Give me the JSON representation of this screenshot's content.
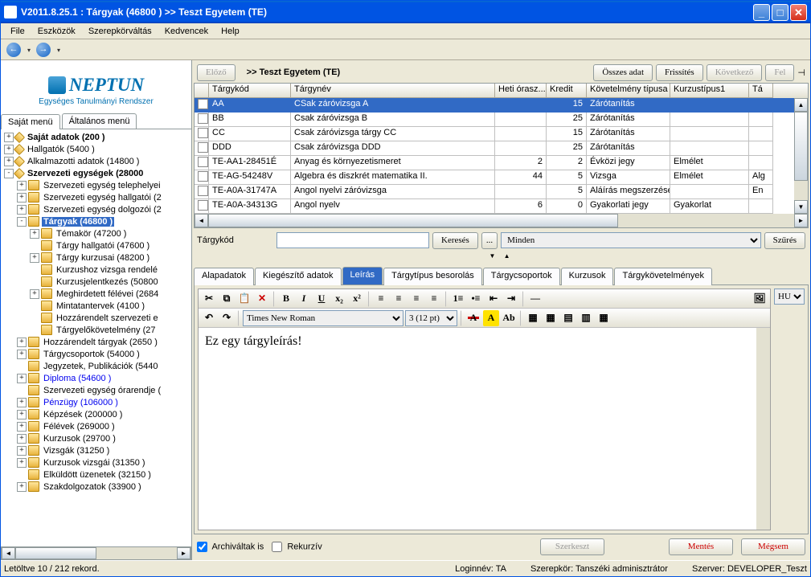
{
  "title": "V2011.8.25.1 : Tárgyak (46800  )   >> Teszt Egyetem  (TE)",
  "menu": [
    "File",
    "Eszközök",
    "Szerepkörváltás",
    "Kedvencek",
    "Help"
  ],
  "logo": {
    "main": "NEPTUN",
    "sub": "Egységes Tanulmányi Rendszer"
  },
  "lefttabs": [
    "Saját menü",
    "Általános menü"
  ],
  "tree": [
    {
      "d": 0,
      "exp": "+",
      "bold": true,
      "ico": "diamond",
      "label": "Saját adatok (200  )"
    },
    {
      "d": 0,
      "exp": "+",
      "ico": "diamond",
      "label": "Hallgatók (5400  )"
    },
    {
      "d": 0,
      "exp": "+",
      "ico": "diamond",
      "label": "Alkalmazotti adatok (14800  )"
    },
    {
      "d": 0,
      "exp": "-",
      "bold": true,
      "ico": "diamond",
      "label": "Szervezeti egységek (28000"
    },
    {
      "d": 1,
      "exp": "+",
      "label": "Szervezeti egység telephelyei"
    },
    {
      "d": 1,
      "exp": "+",
      "label": "Szervezeti egység hallgatói (2"
    },
    {
      "d": 1,
      "exp": "+",
      "label": "Szervezeti egység dolgozói (2"
    },
    {
      "d": 1,
      "exp": "-",
      "bold": true,
      "sel": true,
      "label": "Tárgyak (46800  )"
    },
    {
      "d": 2,
      "exp": "+",
      "label": "Témakör (47200  )"
    },
    {
      "d": 2,
      "exp": " ",
      "label": "Tárgy hallgatói (47600  )"
    },
    {
      "d": 2,
      "exp": "+",
      "label": "Tárgy kurzusai (48200  )"
    },
    {
      "d": 2,
      "exp": " ",
      "label": "Kurzushoz vizsga rendelé"
    },
    {
      "d": 2,
      "exp": " ",
      "label": "Kurzusjelentkezés (50800"
    },
    {
      "d": 2,
      "exp": "+",
      "label": "Meghirdetett félévei (2684"
    },
    {
      "d": 2,
      "exp": " ",
      "label": "Mintatantervek (4100  )"
    },
    {
      "d": 2,
      "exp": " ",
      "label": "Hozzárendelt szervezeti e"
    },
    {
      "d": 2,
      "exp": " ",
      "label": "Tárgyelőkövetelmény (27"
    },
    {
      "d": 1,
      "exp": "+",
      "label": "Hozzárendelt tárgyak (2650  )"
    },
    {
      "d": 1,
      "exp": "+",
      "label": "Tárgycsoportok (54000  )"
    },
    {
      "d": 1,
      "exp": " ",
      "label": "Jegyzetek, Publikációk (5440"
    },
    {
      "d": 1,
      "exp": "+",
      "blue": true,
      "label": "Diploma (54600  )"
    },
    {
      "d": 1,
      "exp": " ",
      "label": "Szervezeti egység órarendje ("
    },
    {
      "d": 1,
      "exp": "+",
      "blue": true,
      "label": "Pénzügy (106000  )"
    },
    {
      "d": 1,
      "exp": "+",
      "label": "Képzések (200000  )"
    },
    {
      "d": 1,
      "exp": "+",
      "label": "Félévek (269000  )"
    },
    {
      "d": 1,
      "exp": "+",
      "label": "Kurzusok (29700  )"
    },
    {
      "d": 1,
      "exp": "+",
      "label": "Vizsgák (31250  )"
    },
    {
      "d": 1,
      "exp": "+",
      "label": "Kurzusok vizsgái (31350  )"
    },
    {
      "d": 1,
      "exp": " ",
      "label": "Elküldött üzenetek (32150  )"
    },
    {
      "d": 1,
      "exp": "+",
      "label": "Szakdolgozatok (33900  )"
    }
  ],
  "breadcrumb": ">>  Teszt Egyetem  (TE)",
  "navbtns": {
    "prev": "Előző",
    "all": "Összes adat",
    "refresh": "Frissítés",
    "next": "Következő",
    "up": "Fel"
  },
  "grid": {
    "headers": [
      "",
      "Tárgykód",
      "Tárgynév",
      "Heti órasz...",
      "Kredit",
      "Követelmény típusa",
      "Kurzustípus1",
      "Tá"
    ],
    "rows": [
      {
        "sel": true,
        "c": [
          "AA",
          "CSak záróvizsga A",
          "",
          "15",
          "Zárótanítás",
          "",
          ""
        ]
      },
      {
        "c": [
          "BB",
          "Csak záróvizsga B",
          "",
          "25",
          "Zárótanítás",
          "",
          ""
        ]
      },
      {
        "c": [
          "CC",
          "Csak záróvizsga tárgy CC",
          "",
          "15",
          "Zárótanítás",
          "",
          ""
        ]
      },
      {
        "c": [
          "DDD",
          "Csak záróvizsga DDD",
          "",
          "25",
          "Zárótanítás",
          "",
          ""
        ]
      },
      {
        "c": [
          "TE-AA1-28451É",
          "Anyag és környezetismeret",
          "2",
          "2",
          "Évközi jegy",
          "Elmélet",
          ""
        ]
      },
      {
        "c": [
          "TE-AG-54248V",
          "Algebra és diszkrét matematika II.",
          "44",
          "5",
          "Vizsga",
          "Elmélet",
          "Alg"
        ]
      },
      {
        "c": [
          "TE-A0A-31747A",
          "Angol nyelvi záróvizsga",
          "",
          "5",
          "Aláírás megszerzése",
          "",
          "En"
        ]
      },
      {
        "c": [
          "TE-A0A-34313G",
          "Angol nyelv",
          "6",
          "0",
          "Gyakorlati jegy",
          "Gyakorlat",
          ""
        ]
      }
    ]
  },
  "search": {
    "label": "Tárgykód",
    "btn": "Keresés",
    "dots": "...",
    "filter": "Minden",
    "filterbtn": "Szűrés"
  },
  "tabs": [
    "Alapadatok",
    "Kiegészítő adatok",
    "Leírás",
    "Tárgytípus besorolás",
    "Tárgycsoportok",
    "Kurzusok",
    "Tárgykövetelmények"
  ],
  "active_tab": 2,
  "editor": {
    "font": "Times New Roman",
    "size": "3 (12 pt)",
    "lang": "HU",
    "content": "Ez egy tárgyleírás!"
  },
  "bottom": {
    "archived": "Archiváltak is",
    "recursive": "Rekurzív",
    "edit": "Szerkeszt",
    "save": "Mentés",
    "cancel": "Mégsem"
  },
  "status": {
    "left": "Letöltve 10 / 212 rekord.",
    "login": "Loginnév: TA",
    "role": "Szerepkör: Tanszéki adminisztrátor",
    "server": "Szerver: DEVELOPER_Teszt"
  }
}
